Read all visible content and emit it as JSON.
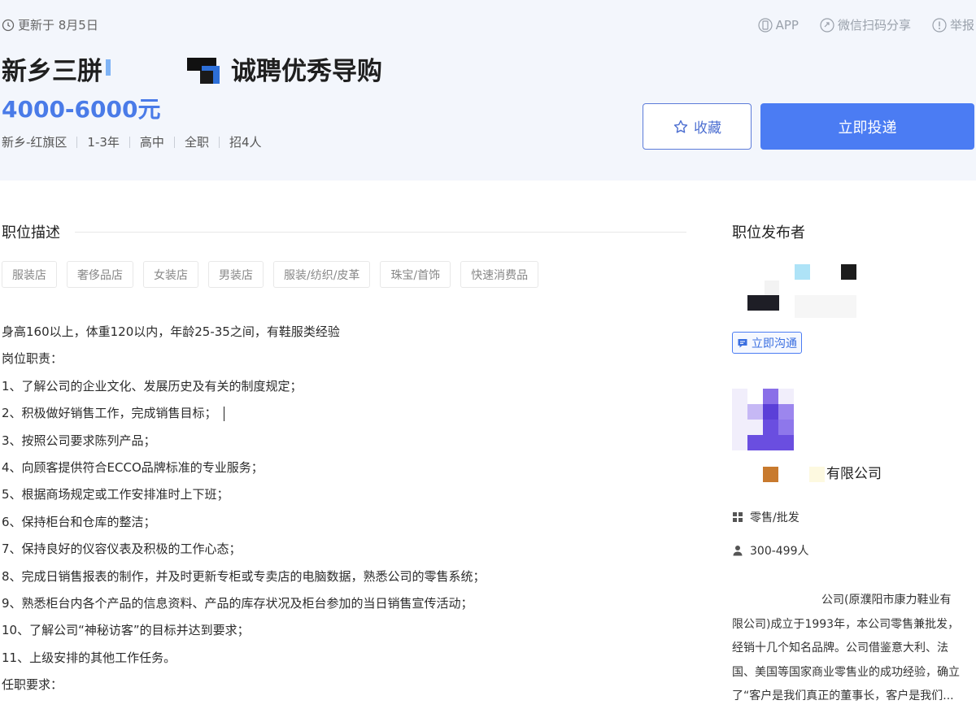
{
  "header": {
    "updated": "更新于 8月5日",
    "actions": {
      "app": "APP",
      "share": "微信扫码分享",
      "report": "举报"
    },
    "title_prefix": "新乡三胼",
    "title_suffix": "诚聘优秀导购",
    "salary": "4000-6000元",
    "meta": [
      "新乡-红旗区",
      "1-3年",
      "高中",
      "全职",
      "招4人"
    ],
    "favorite_label": "收藏",
    "apply_label": "立即投递"
  },
  "description": {
    "section_title": "职位描述",
    "tags": [
      "服装店",
      "奢侈品店",
      "女装店",
      "男装店",
      "服装/纺织/皮革",
      "珠宝/首饰",
      "快速消费品"
    ],
    "lines": [
      "身高160以上，体重120以内，年龄25-35之间，有鞋服类经验",
      "岗位职责：",
      "1、了解公司的企业文化、发展历史及有关的制度规定；",
      "2、积极做好销售工作，完成销售目标；",
      "3、按照公司要求陈列产品；",
      "4、向顾客提供符合ECCO品牌标准的专业服务；",
      "5、根据商场规定或工作安排准时上下班；",
      "6、保持柜台和仓库的整洁；",
      "7、保持良好的仪容仪表及积极的工作心态；",
      "8、完成日销售报表的制作，并及时更新专柜或专卖店的电脑数据，熟悉公司的零售系统；",
      "9、熟悉柜台内各个产品的信息资料、产品的库存状况及柜台参加的当日销售宣传活动；",
      "10、了解公司“神秘访客”的目标并达到要求；",
      "11、上级安排的其他工作任务。",
      "任职要求："
    ]
  },
  "sidebar": {
    "title": "职位发布者",
    "chat_label": "立即沟通",
    "company_name_suffix": "有限公司",
    "industry": "零售/批发",
    "size": "300-499人",
    "intro_lines": [
      "公司(原濮阳市康力鞋业有",
      "限公司)成立于1993年，本公司零售兼批发，",
      "经销十几个知名品牌。公司借鉴意大利、法",
      "国、美国等国家商业零售业的成功经验，确立",
      "了“客户是我们真正的董事长，客户是我们..."
    ]
  },
  "colors": {
    "accent": "#4b7cf3",
    "salary": "#4a7be8",
    "header_bg": "#f3f6fc"
  }
}
